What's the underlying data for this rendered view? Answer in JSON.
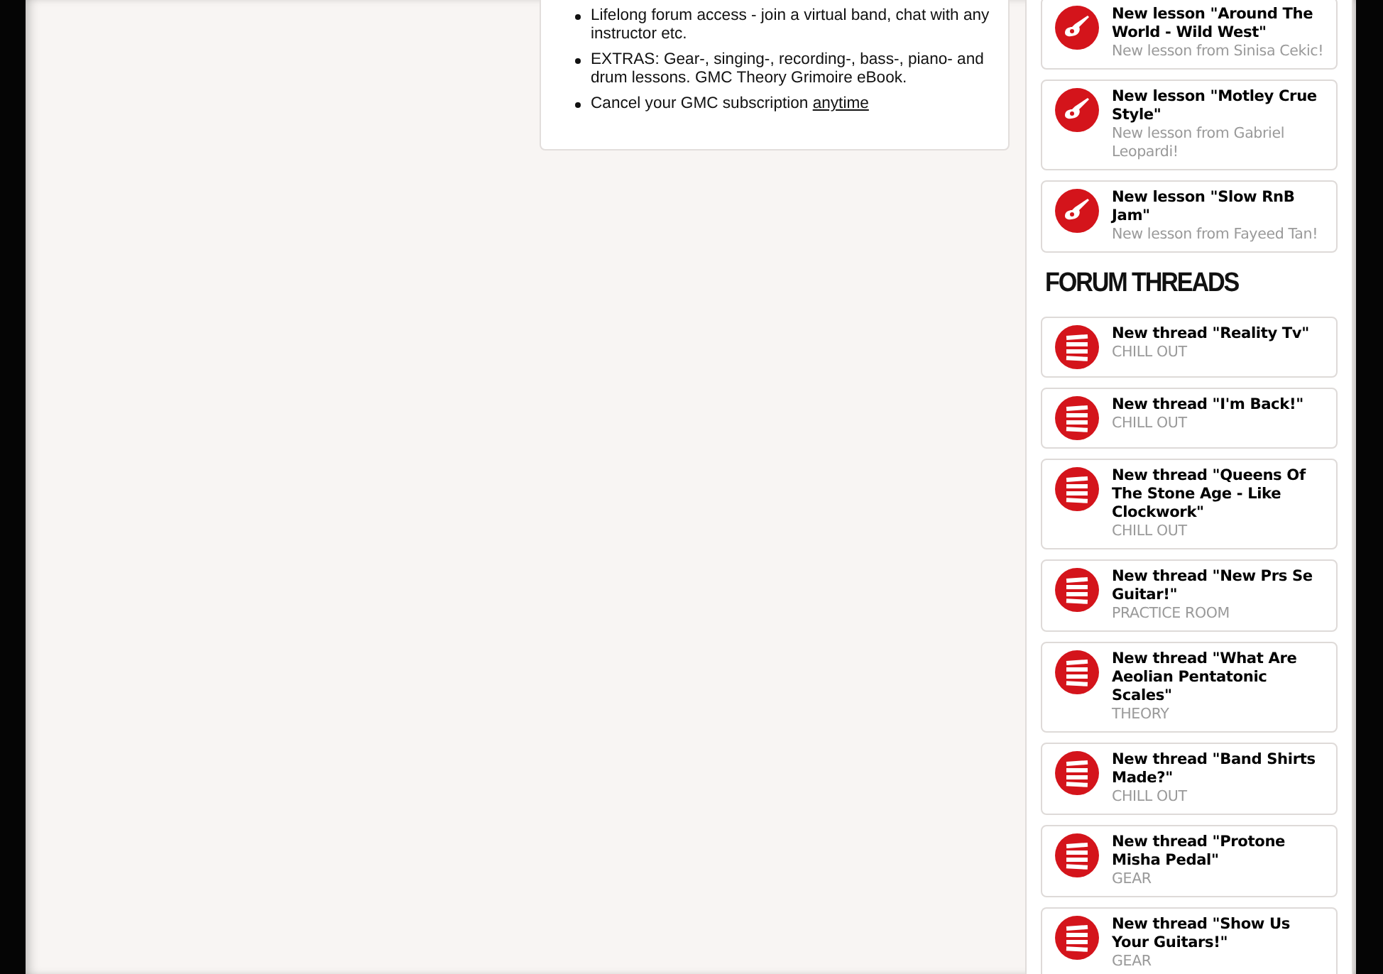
{
  "features": [
    {
      "text": "Lifelong forum access - join a virtual band, chat with any instructor etc."
    },
    {
      "text": "EXTRAS: Gear-, singing-, recording-, bass-, piano- and drum lessons. GMC Theory Grimoire eBook."
    },
    {
      "text": "Cancel your GMC subscription",
      "link": "anytime"
    }
  ],
  "lessons": [
    {
      "title": "New lesson \"Around The World - Wild West\"",
      "subtitle": "New lesson from Sinisa Cekic!"
    },
    {
      "title": "New lesson \"Motley Crue Style\"",
      "subtitle": "New lesson from Gabriel Leopardi!"
    },
    {
      "title": "New lesson \"Slow RnB Jam\"",
      "subtitle": "New lesson from Fayeed Tan!"
    }
  ],
  "forum_threads": {
    "heading": "FORUM THREADS",
    "items": [
      {
        "title": "New thread \"Reality Tv\"",
        "category": "CHILL OUT"
      },
      {
        "title": "New thread \"I'm Back!\"",
        "category": "CHILL OUT"
      },
      {
        "title": "New thread \"Queens Of The Stone Age - Like Clockwork\"",
        "category": "CHILL OUT"
      },
      {
        "title": "New thread \"New Prs Se Guitar!\"",
        "category": "PRACTICE ROOM"
      },
      {
        "title": "New thread \"What Are Aeolian Pentatonic Scales\"",
        "category": "THEORY"
      },
      {
        "title": "New thread \"Band Shirts Made?\"",
        "category": "CHILL OUT"
      },
      {
        "title": "New thread \"Protone Misha Pedal\"",
        "category": "GEAR"
      },
      {
        "title": "New thread \"Show Us Your Guitars!\"",
        "category": "GEAR"
      }
    ]
  }
}
